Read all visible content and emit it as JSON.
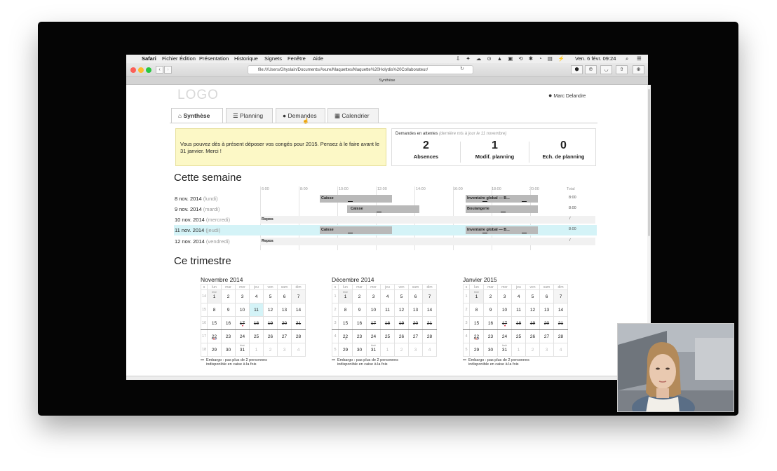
{
  "menubar": {
    "app": "Safari",
    "items": [
      "Fichier",
      "Édition",
      "Présentation",
      "Historique",
      "Signets",
      "Fenêtre",
      "Aide"
    ],
    "clock": "Ven. 6 févr. 09:24"
  },
  "browser": {
    "url": "file:///Users/Ghyslain/Documents/Axure/Maquettes/Maquette%20Holydis%20Collaborateur/",
    "tab_title": "Synthèse"
  },
  "header": {
    "logo": "LOGO",
    "user": "Marc Delandre"
  },
  "tabs": [
    {
      "label": "Synthèse",
      "icon": "home-icon",
      "active": true
    },
    {
      "label": "Planning",
      "icon": "list-icon",
      "active": false
    },
    {
      "label": "Demandes",
      "icon": "comment-icon",
      "active": false
    },
    {
      "label": "Calendrier",
      "icon": "calendar-icon",
      "active": false
    }
  ],
  "notice": "Vous pouvez dès à présent déposer vos congés pour 2015. Pensez à le faire avant le 31 janvier. Merci !",
  "stats": {
    "title": "Demandes en attentes",
    "note": "(dernière mis à jour le 11 novembre)",
    "items": [
      {
        "value": "2",
        "label": "Absences"
      },
      {
        "value": "1",
        "label": "Modif. planning"
      },
      {
        "value": "0",
        "label": "Ech. de planning"
      }
    ]
  },
  "week": {
    "title": "Cette semaine",
    "times": [
      "6:00",
      "8:00",
      "10:00",
      "12:00",
      "14:00",
      "16:00",
      "18:00",
      "20:00",
      "Total"
    ],
    "rows": [
      {
        "date": "8 nov. 2014",
        "day": "(lundi)",
        "bars": [
          "Caisse",
          "Inventaire global — B..."
        ],
        "total": "8:00"
      },
      {
        "date": "9 nov. 2014",
        "day": "(mardi)",
        "bars": [
          "Caisse",
          "Boulangerie"
        ],
        "total": "8:00"
      },
      {
        "date": "10 nov. 2014",
        "day": "(mercredi)",
        "rest": "Repos",
        "total": "/"
      },
      {
        "date": "11 nov. 2014",
        "day": "(jeudi)",
        "bars": [
          "Caisse",
          "Inventaire global — B..."
        ],
        "total": "8:00"
      },
      {
        "date": "12 nov. 2014",
        "day": "(vendredi)",
        "rest": "Repos",
        "total": "/"
      }
    ]
  },
  "quarter": {
    "title": "Ce trimestre",
    "weekday_headers": [
      "s",
      "lun",
      "mar",
      "mer",
      "jeu",
      "ven",
      "sam",
      "dim"
    ],
    "ferie_label": "férié",
    "months": [
      {
        "title": "Novembre 2014",
        "weeks": [
          [
            "14",
            "1",
            "2",
            "3",
            "4",
            "5",
            "6",
            "7"
          ],
          [
            "15",
            "8",
            "9",
            "10",
            "11",
            "12",
            "13",
            "14"
          ],
          [
            "16",
            "15",
            "16",
            "17",
            "18",
            "19",
            "20",
            "21"
          ],
          [
            "17",
            "22",
            "23",
            "24",
            "25",
            "26",
            "27",
            "28"
          ],
          [
            "18",
            "29",
            "30",
            "31",
            "1",
            "2",
            "3",
            "4"
          ]
        ],
        "embargo": [
          "Embargo : pas plus de 2 personnes",
          "indisponible en caise à la fois"
        ]
      },
      {
        "title": "Décembre 2014",
        "weeks": [
          [
            "1",
            "1",
            "2",
            "3",
            "4",
            "5",
            "6",
            "7"
          ],
          [
            "2",
            "8",
            "9",
            "10",
            "11",
            "12",
            "13",
            "14"
          ],
          [
            "3",
            "15",
            "16",
            "17",
            "18",
            "19",
            "20",
            "21"
          ],
          [
            "4",
            "22",
            "23",
            "24",
            "25",
            "26",
            "27",
            "28"
          ],
          [
            "5",
            "29",
            "30",
            "31",
            "1",
            "2",
            "3",
            "4"
          ]
        ],
        "embargo": [
          "Embargo : pas plus de 2 personnes",
          "indisponible en caise à la fois"
        ]
      },
      {
        "title": "Janvier 2015",
        "weeks": [
          [
            "1",
            "1",
            "2",
            "3",
            "4",
            "5",
            "6",
            "7"
          ],
          [
            "2",
            "8",
            "9",
            "10",
            "11",
            "12",
            "13",
            "14"
          ],
          [
            "3",
            "15",
            "16",
            "17",
            "18",
            "19",
            "20",
            "21"
          ],
          [
            "4",
            "22",
            "23",
            "24",
            "25",
            "26",
            "27",
            "28"
          ],
          [
            "5",
            "29",
            "30",
            "31",
            "1",
            "2",
            "3",
            "4"
          ]
        ],
        "embargo": [
          "Embargo : pas plus de 2 personnes",
          "indisponible en caise à la fois"
        ]
      }
    ]
  },
  "colors": {
    "highlight": "#d4f3f7",
    "notice_bg": "#fcf8c6",
    "bar": "#b9b9b9"
  }
}
